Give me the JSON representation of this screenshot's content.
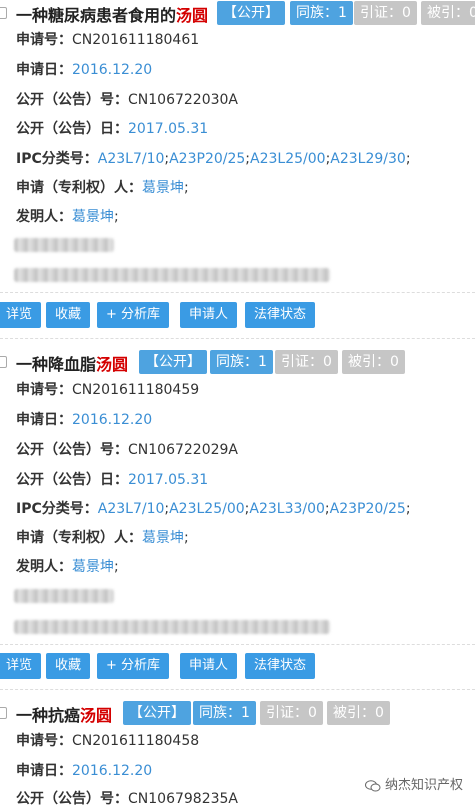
{
  "labels": {
    "app_no": "申请号：",
    "app_date": "申请日：",
    "pub_no": "公开（公告）号：",
    "pub_date": "公开（公告）日：",
    "ipc": "IPC分类号：",
    "applicant": "申请（专利权）人：",
    "inventor": "发明人："
  },
  "actions": {
    "preview": "详览",
    "favorite": "收藏",
    "add_library": "+ 分析库",
    "applicant": "申请人",
    "legal_status": "法律状态"
  },
  "records": [
    {
      "title_prefix": "一种糖尿病患者食用的",
      "title_keyword": "汤圆",
      "status": "【公开】",
      "family": "同族：1",
      "cited": "引证：0",
      "cited_by": "被引：0",
      "app_no": "CN201611180461",
      "app_date": "2016.12.20",
      "pub_no": "CN106722030A",
      "pub_date": "2017.05.31",
      "ipc": [
        "A23L7/10",
        "A23P20/25",
        "A23L25/00",
        "A23L29/30"
      ],
      "applicant": "葛景坤",
      "inventor": "葛景坤"
    },
    {
      "title_prefix": "一种降血脂",
      "title_keyword": "汤圆",
      "status": "【公开】",
      "family": "同族：1",
      "cited": "引证：0",
      "cited_by": "被引：0",
      "app_no": "CN201611180459",
      "app_date": "2016.12.20",
      "pub_no": "CN106722029A",
      "pub_date": "2017.05.31",
      "ipc": [
        "A23L7/10",
        "A23L25/00",
        "A23L33/00",
        "A23P20/25"
      ],
      "applicant": "葛景坤",
      "inventor": "葛景坤"
    },
    {
      "title_prefix": "一种抗癌",
      "title_keyword": "汤圆",
      "status": "【公开】",
      "family": "同族：1",
      "cited": "引证：0",
      "cited_by": "被引：0",
      "app_no": "CN201611180458",
      "app_date": "2016.12.20",
      "pub_no": "CN106798235A"
    }
  ],
  "watermark": "纳杰知识产权"
}
